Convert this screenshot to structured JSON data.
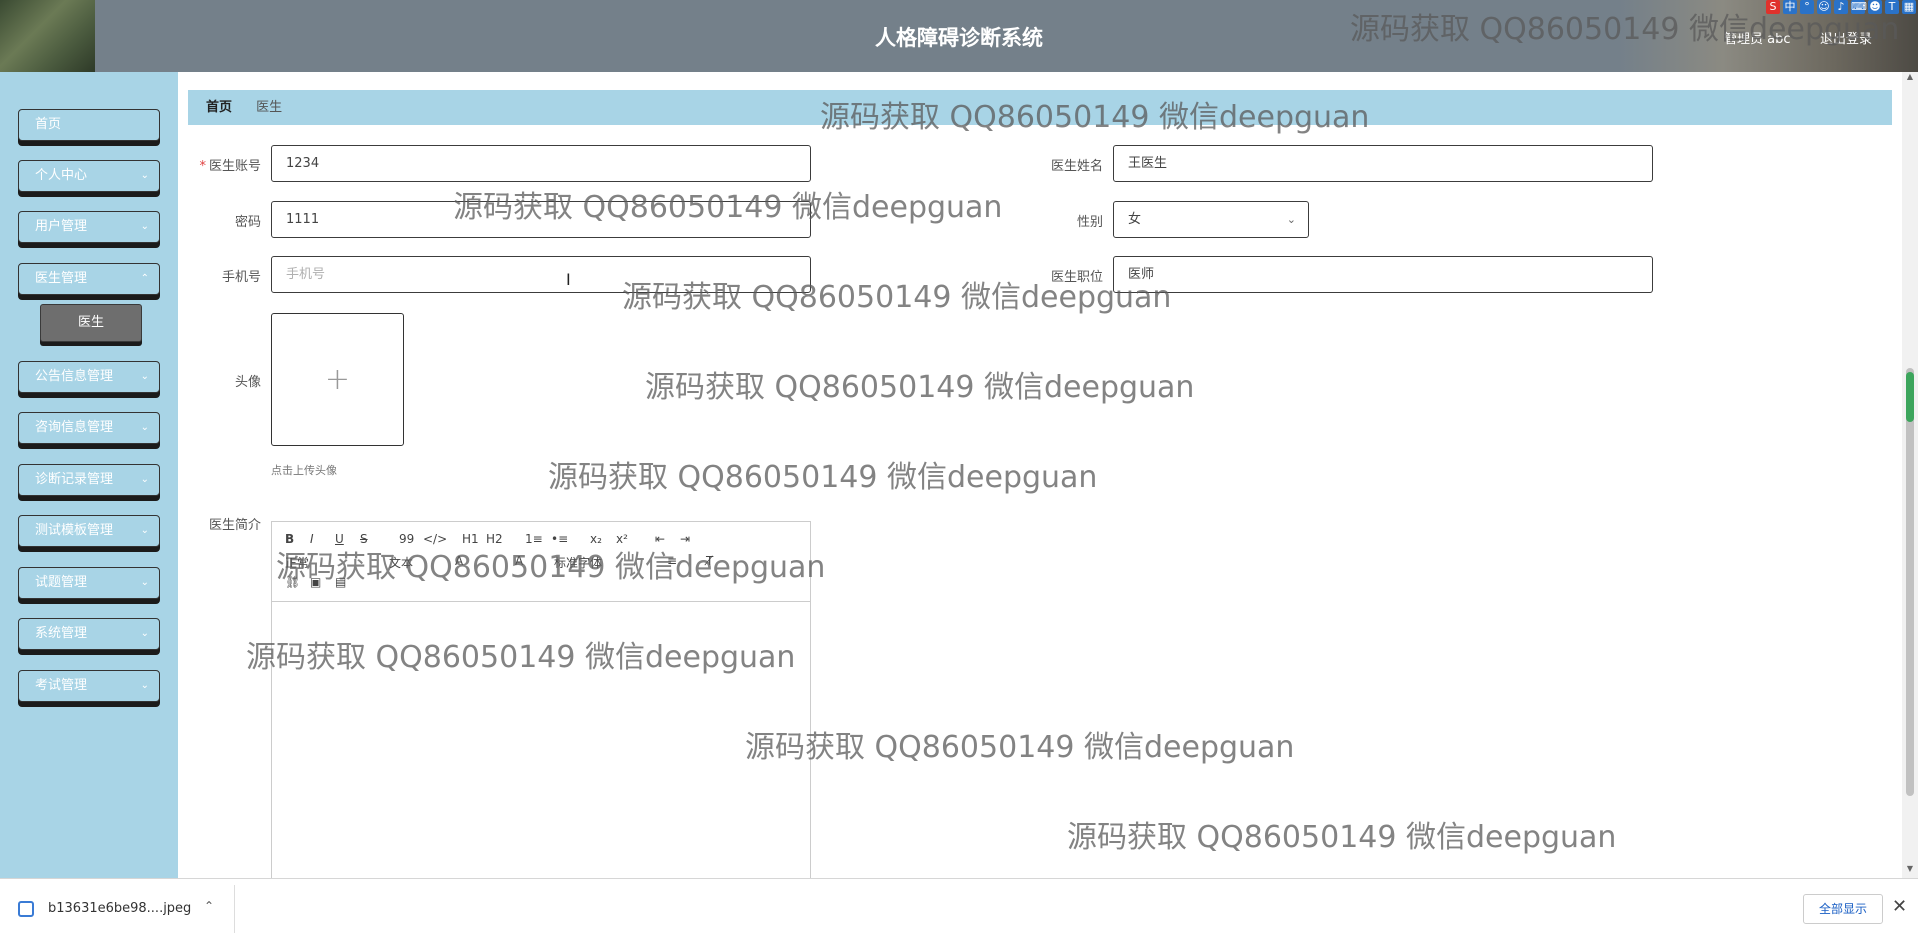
{
  "header": {
    "title": "人格障碍诊断系统",
    "admin_user": "管理员 abc",
    "logout": "退出登录"
  },
  "sidebar": {
    "items": [
      {
        "label": "首页",
        "has_chevron": false
      },
      {
        "label": "个人中心",
        "has_chevron": true
      },
      {
        "label": "用户管理",
        "has_chevron": true
      },
      {
        "label": "医生管理",
        "has_chevron": true
      },
      {
        "label": "公告信息管理",
        "has_chevron": true
      },
      {
        "label": "咨询信息管理",
        "has_chevron": true
      },
      {
        "label": "诊断记录管理",
        "has_chevron": true
      },
      {
        "label": "测试模板管理",
        "has_chevron": true
      },
      {
        "label": "试题管理",
        "has_chevron": true
      },
      {
        "label": "系统管理",
        "has_chevron": true
      },
      {
        "label": "考试管理",
        "has_chevron": true
      }
    ],
    "submenu_active": "医生"
  },
  "breadcrumb": {
    "home": "首页",
    "current": "医生"
  },
  "form": {
    "account": {
      "label": "医生账号",
      "value": "1234",
      "required": true
    },
    "name": {
      "label": "医生姓名",
      "value": "王医生"
    },
    "password": {
      "label": "密码",
      "value": "1111"
    },
    "gender": {
      "label": "性别",
      "value": "女"
    },
    "phone": {
      "label": "手机号",
      "value": "",
      "placeholder": "手机号"
    },
    "position": {
      "label": "医生职位",
      "value": "医师"
    },
    "avatar": {
      "label": "头像",
      "hint": "点击上传头像",
      "plus": "+"
    },
    "intro": {
      "label": "医生简介"
    }
  },
  "editor_toolbar": {
    "row1": [
      "B",
      "I",
      "U",
      "S",
      "99",
      "</>",
      "H1",
      "H2",
      "1≡",
      "•≡",
      "x₂",
      "x²",
      "⇤",
      "⇥"
    ],
    "row2": [
      "正常",
      "文本",
      "标准字体"
    ],
    "row3_icons": [
      "link-icon",
      "image-icon",
      "video-icon"
    ]
  },
  "watermark": "源码获取 QQ86050149 微信deepguan",
  "download_bar": {
    "file_name": "b13631e6be98....jpeg",
    "show_all": "全部显示",
    "close": "✕"
  },
  "colors": {
    "header_bg": "#74808a",
    "sidebar_bg": "#a8d4e6",
    "submenu_bg": "#6e6e6e"
  }
}
